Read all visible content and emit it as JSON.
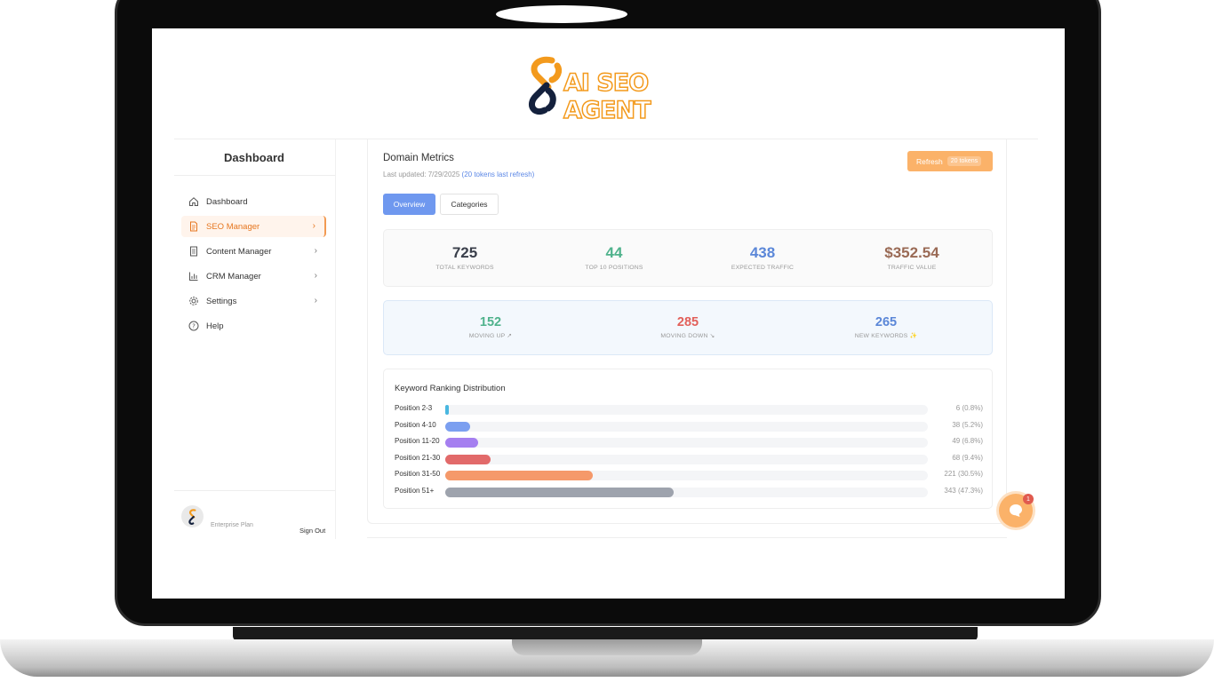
{
  "brand": {
    "logo_text": "AI SEO AGENT",
    "accent": "#f39a1d"
  },
  "sidebar": {
    "title": "Dashboard",
    "items": [
      {
        "label": "Dashboard",
        "icon": "home-icon"
      },
      {
        "label": "SEO Manager",
        "icon": "document-icon",
        "active": true
      },
      {
        "label": "Content Manager",
        "icon": "file-icon"
      },
      {
        "label": "CRM Manager",
        "icon": "bar-chart-icon"
      },
      {
        "label": "Settings",
        "icon": "gear-icon"
      },
      {
        "label": "Help",
        "icon": "help-icon"
      }
    ],
    "footer": {
      "plan": "Enterprise Plan",
      "sign_out": "Sign Out"
    }
  },
  "main": {
    "title": "Domain Metrics",
    "updated_prefix": "Last updated: 7/29/2025 ",
    "updated_link": "(20 tokens last refresh)",
    "refresh_label": "Refresh",
    "refresh_badge": "20 tokens",
    "tabs": [
      {
        "label": "Overview",
        "active": true
      },
      {
        "label": "Categories"
      }
    ],
    "stats": [
      {
        "value": "725",
        "label": "TOTAL KEYWORDS",
        "color": "#3a3f4b"
      },
      {
        "value": "44",
        "label": "TOP 10 POSITIONS",
        "color": "#4fb28c"
      },
      {
        "value": "438",
        "label": "EXPECTED TRAFFIC",
        "color": "#5b87d8"
      },
      {
        "value": "$352.54",
        "label": "TRAFFIC VALUE",
        "color": "#9a6a55"
      }
    ],
    "movement": [
      {
        "value": "152",
        "label": "MOVING UP ↗",
        "color": "#4fb28c"
      },
      {
        "value": "285",
        "label": "MOVING DOWN ↘",
        "color": "#e2605a"
      },
      {
        "value": "265",
        "label": "NEW KEYWORDS ✨",
        "color": "#5b87d8"
      }
    ],
    "distribution": {
      "title": "Keyword Ranking Distribution",
      "rows": [
        {
          "label": "Position 2-3",
          "value": "6 (0.8%)",
          "fraction": 0.008,
          "color": "#49b7e0"
        },
        {
          "label": "Position 4-10",
          "value": "38 (5.2%)",
          "fraction": 0.052,
          "color": "#7b9ff0"
        },
        {
          "label": "Position 11-20",
          "value": "49 (6.8%)",
          "fraction": 0.068,
          "color": "#a57ff0"
        },
        {
          "label": "Position 21-30",
          "value": "68 (9.4%)",
          "fraction": 0.094,
          "color": "#e26a6a"
        },
        {
          "label": "Position 31-50",
          "value": "221 (30.5%)",
          "fraction": 0.305,
          "color": "#f5996a"
        },
        {
          "label": "Position 51+",
          "value": "343 (47.3%)",
          "fraction": 0.473,
          "color": "#9ea3ad"
        }
      ]
    }
  },
  "chat": {
    "badge": "1"
  }
}
